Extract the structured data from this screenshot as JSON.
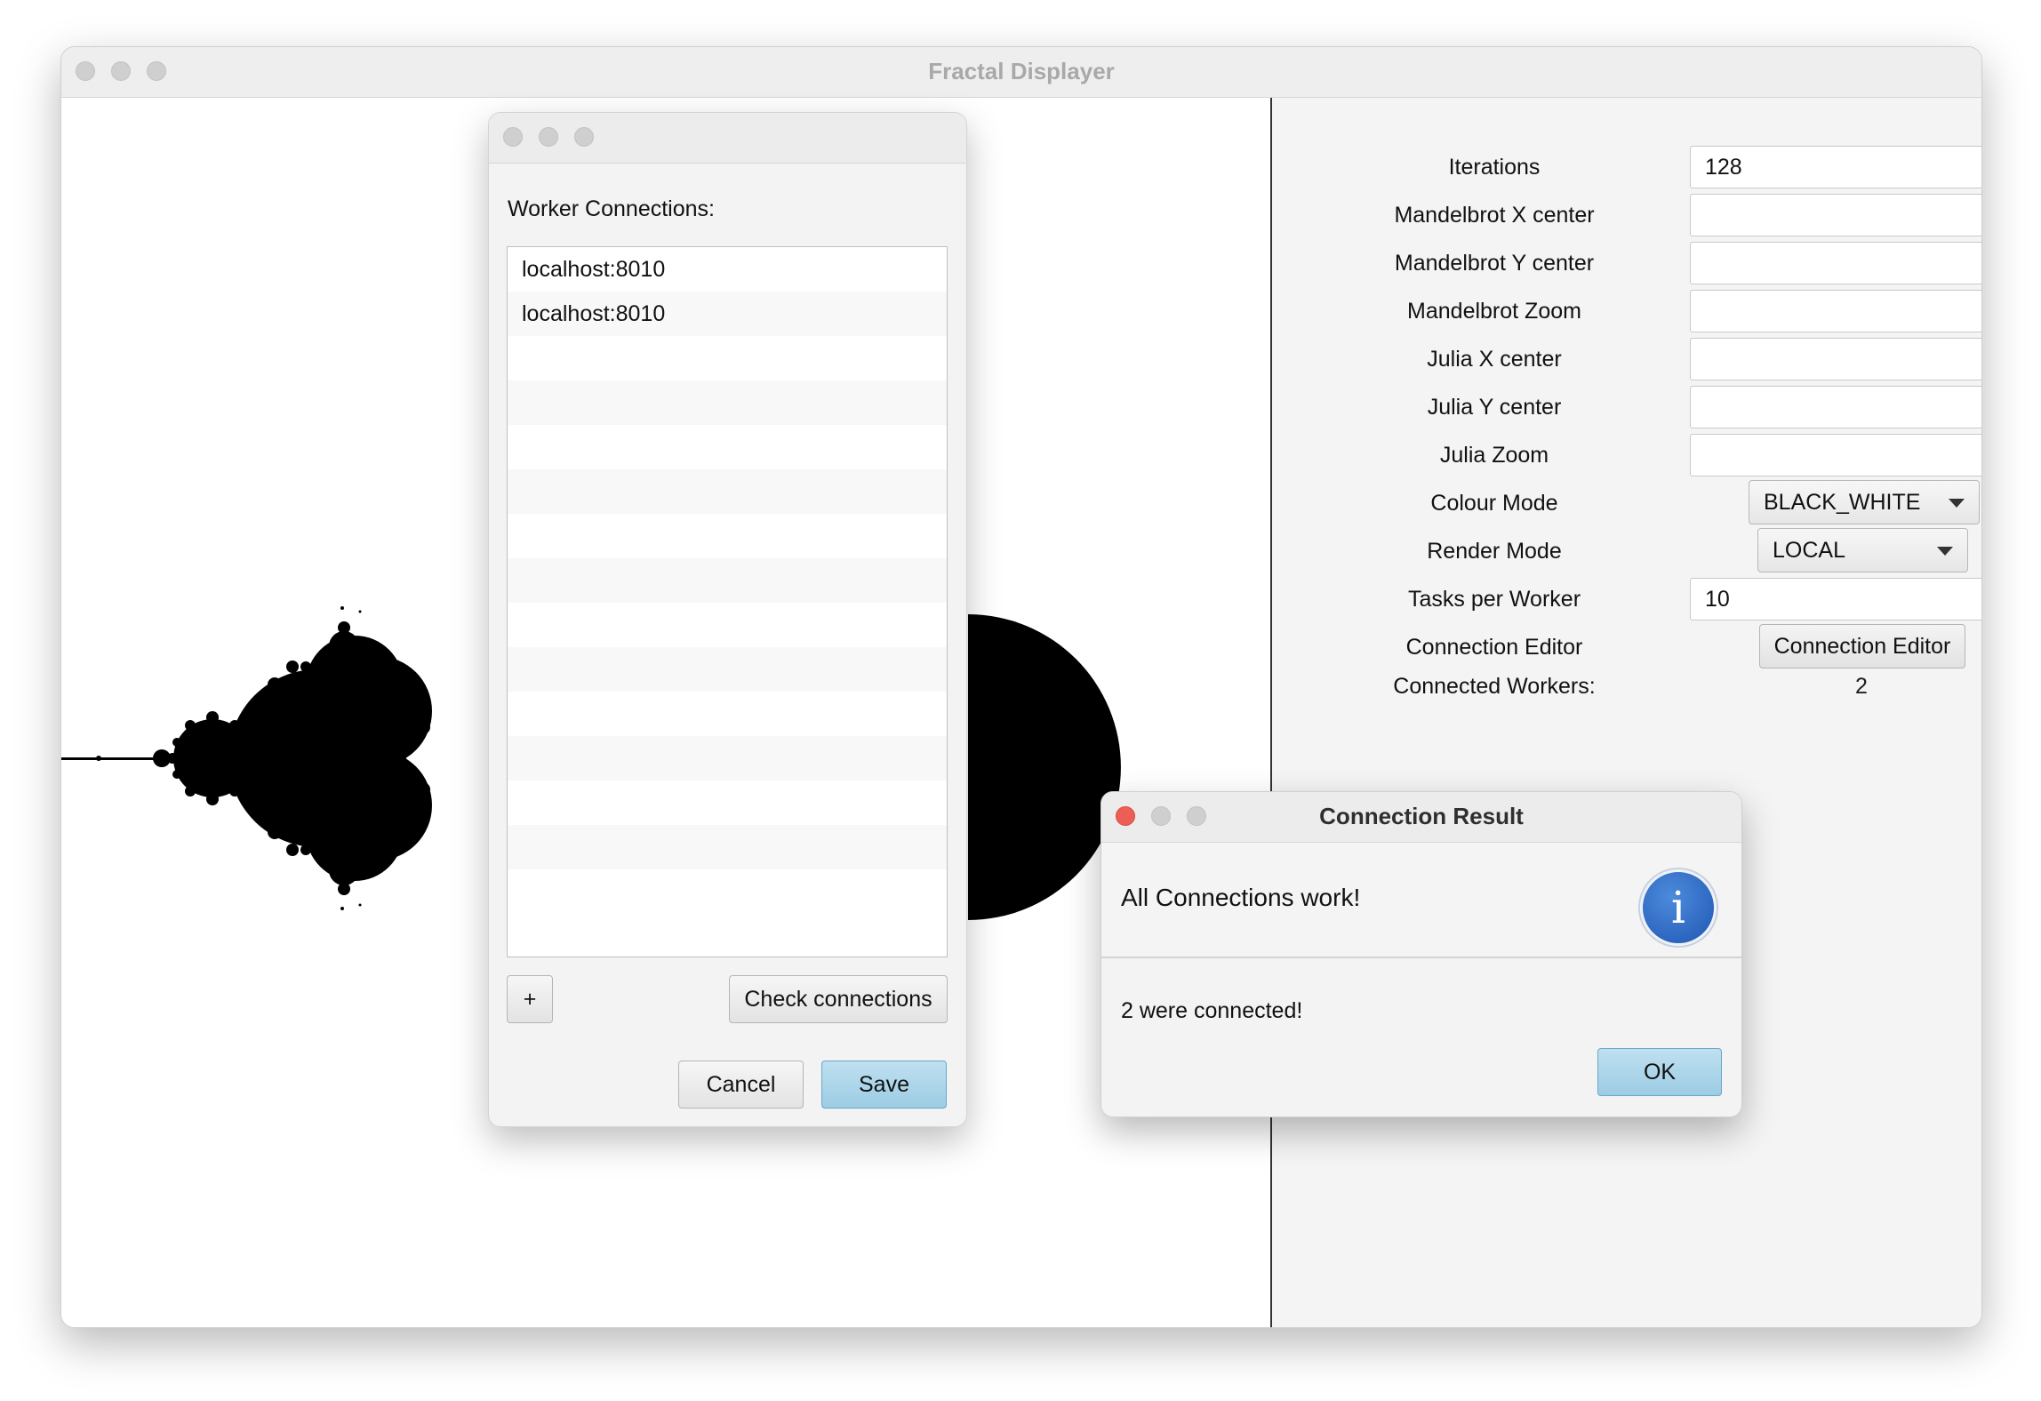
{
  "main_window": {
    "title": "Fractal Displayer"
  },
  "controls": {
    "iterations": {
      "label": "Iterations",
      "value": "128"
    },
    "mandel_x": {
      "label": "Mandelbrot X center",
      "value": ""
    },
    "mandel_y": {
      "label": "Mandelbrot Y center",
      "value": ""
    },
    "mandel_zoom": {
      "label": "Mandelbrot Zoom",
      "value": ""
    },
    "julia_x": {
      "label": "Julia X center",
      "value": ""
    },
    "julia_y": {
      "label": "Julia Y center",
      "value": ""
    },
    "julia_zoom": {
      "label": "Julia Zoom",
      "value": ""
    },
    "colour_mode": {
      "label": "Colour Mode",
      "value": "BLACK_WHITE"
    },
    "render_mode": {
      "label": "Render Mode",
      "value": "LOCAL"
    },
    "tasks_per_worker": {
      "label": "Tasks per Worker",
      "value": "10"
    },
    "connection_editor": {
      "label": "Connection Editor",
      "button": "Connection Editor"
    },
    "connected_workers": {
      "label": "Connected Workers:",
      "value": "2"
    }
  },
  "worker_dialog": {
    "heading": "Worker Connections:",
    "connections": [
      "localhost:8010",
      "localhost:8010"
    ],
    "add_label": "+",
    "check_label": "Check connections",
    "cancel_label": "Cancel",
    "save_label": "Save"
  },
  "result_dialog": {
    "title": "Connection Result",
    "header": "All Connections work!",
    "icon": "info-icon",
    "message": "2 were connected!",
    "ok_label": "OK"
  },
  "colors": {
    "accent": "#9ccce4",
    "close_red": "#ed5e56",
    "info_blue": "#2a62c0"
  }
}
